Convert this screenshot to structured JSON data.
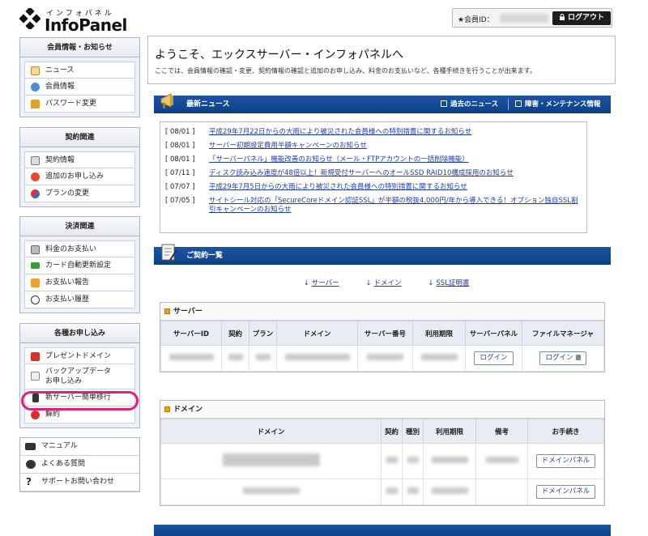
{
  "header": {
    "logo_kana": "インフォパネル",
    "logo_name": "InfoPanel",
    "member_label": "★会員ID：",
    "logout_label": "ログアウト"
  },
  "sidebar": {
    "groups": [
      {
        "title": "会員情報・お知らせ",
        "items": [
          "ニュース",
          "会員情報",
          "パスワード変更"
        ]
      },
      {
        "title": "契約関連",
        "items": [
          "契約情報",
          "追加のお申し込み",
          "プランの変更"
        ]
      },
      {
        "title": "決済関連",
        "items": [
          "料金のお支払い",
          "カード自動更新設定",
          "お支払い報告",
          "お支払い履歴"
        ]
      },
      {
        "title": "各種お申し込み",
        "items": [
          "プレゼントドメイン",
          "バックアップデータ",
          "お申し込み",
          "新サーバー簡単移行",
          "解約"
        ]
      }
    ],
    "links": [
      "マニュアル",
      "よくある質問",
      "サポートお問い合わせ"
    ]
  },
  "welcome": {
    "title": "ようこそ、エックスサーバー・インフォパネルへ",
    "desc": "ここでは、会員情報の確認・変更、契約情報の確認と追加のお申し込み、料金のお支払いなど、各種手続きを行うことが出来ます。"
  },
  "news_bar": {
    "title": "最新ニュース",
    "link1": "過去のニュース",
    "link2": "障害・メンテナンス情報"
  },
  "news": [
    {
      "date": "[ 08/01 ]",
      "text": "平成29年7月22日からの大雨により被災された会員様への特別措置に関するお知らせ"
    },
    {
      "date": "[ 08/01 ]",
      "text": "サーバー初期設定費用半額キャンペーンのお知らせ"
    },
    {
      "date": "[ 08/01 ]",
      "text": "「サーバーパネル」機能改善のお知らせ（メール・FTPアカウントの一括削除機能）"
    },
    {
      "date": "[ 07/11 ]",
      "text": "ディスク読み込み速度が48倍以上！新規受付サーバーへのオールSSD RAID10構成採用のお知らせ"
    },
    {
      "date": "[ 07/07 ]",
      "text": "平成29年7月5日からの大雨により被災された会員様への特別措置に関するお知らせ"
    },
    {
      "date": "[ 07/05 ]",
      "text": "サイトシール対応の「SecureCoreドメイン認証SSL」が半額の税抜4,000円/年から導入できる！オプション独自SSL割引キャンペーンのお知らせ"
    }
  ],
  "contract_bar": {
    "title": "ご契約一覧"
  },
  "quick": {
    "arrow": "↓",
    "links": [
      "サーバー",
      "ドメイン",
      "SSL証明書"
    ]
  },
  "server": {
    "title": "サーバー",
    "headers": [
      "サーバーID",
      "契約",
      "プラン",
      "ドメイン",
      "サーバー番号",
      "利用期限",
      "サーバーパネル",
      "ファイルマネージャ"
    ],
    "button": "ログイン"
  },
  "domain": {
    "title": "ドメイン",
    "headers": [
      "ドメイン",
      "契約",
      "種別",
      "利用期限",
      "備考",
      "お手続き"
    ],
    "button": "ドメインパネル"
  },
  "colors": {
    "accent": "#0d3f86",
    "highlight": "#e0207a",
    "link": "#1f3ab0"
  }
}
